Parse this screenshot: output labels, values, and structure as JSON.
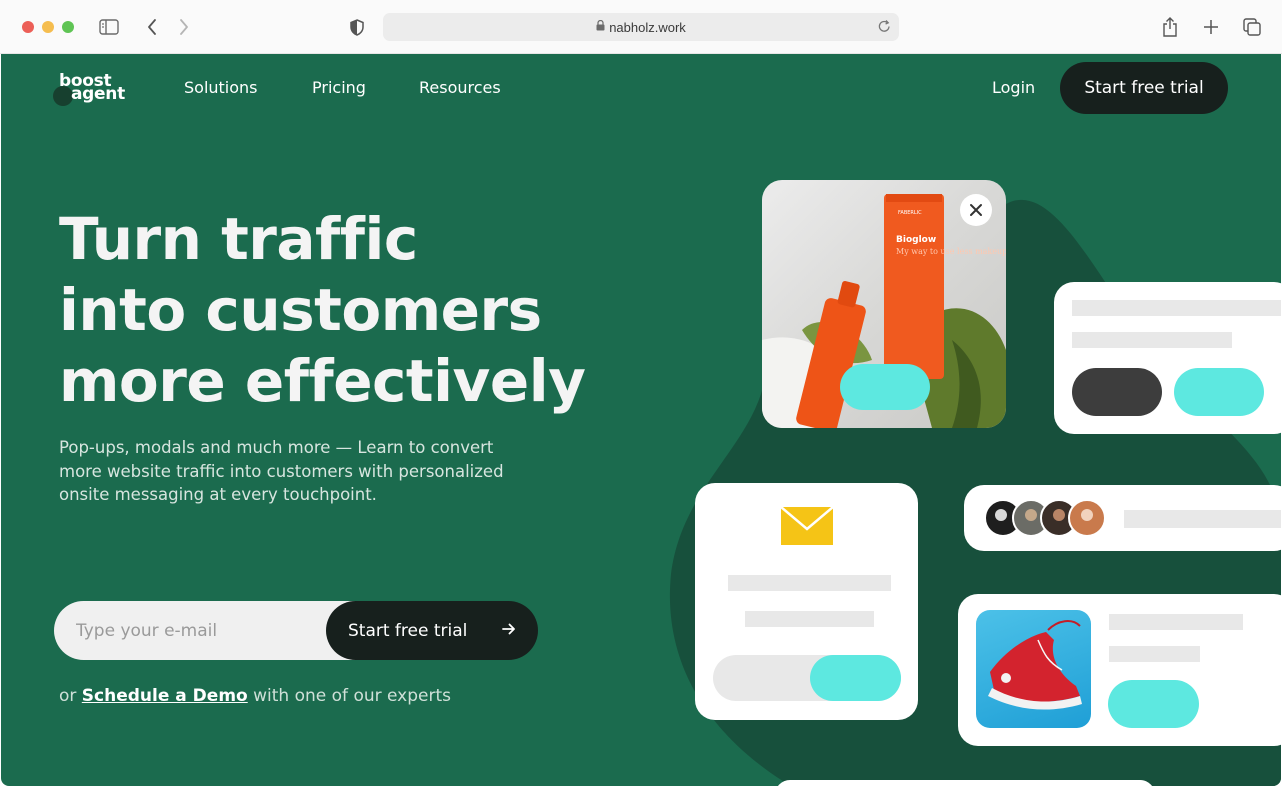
{
  "browser": {
    "url": "nabholz.work"
  },
  "nav": {
    "logo_line1": "boost",
    "logo_line2": "agent",
    "links": [
      "Solutions",
      "Pricing",
      "Resources"
    ],
    "login": "Login",
    "cta": "Start free trial"
  },
  "hero": {
    "headline_line1": "Turn traffic",
    "headline_line2": "into customers",
    "headline_line3": "more effectively",
    "subtext": "Pop-ups, modals and much more — Learn to convert more website traffic into customers with personalized onsite messaging at every touchpoint.",
    "email_placeholder": "Type your e-mail",
    "email_button": "Start free trial",
    "demo_prefix": "or",
    "demo_link": "Schedule a Demo",
    "demo_suffix": "with one of our experts"
  },
  "product_popup": {
    "brand": "FABERLIC",
    "product_name": "Bioglow",
    "product_tagline": "My way to use less makeup"
  },
  "colors": {
    "page_bg": "#1b6b4e",
    "blob": "#17503c",
    "dark_button": "#17201d",
    "teal_accent": "#5de8e0",
    "envelope": "#f5c416"
  },
  "icons": {
    "close": "close-icon",
    "envelope": "envelope-icon",
    "arrow": "arrow-right-icon",
    "share": "share-icon",
    "new_tab": "plus-icon",
    "tabs": "tabs-icon",
    "sidebar": "sidebar-icon",
    "back": "chevron-left-icon",
    "forward": "chevron-right-icon",
    "shield": "shield-icon",
    "lock": "lock-icon",
    "reload": "reload-icon"
  }
}
